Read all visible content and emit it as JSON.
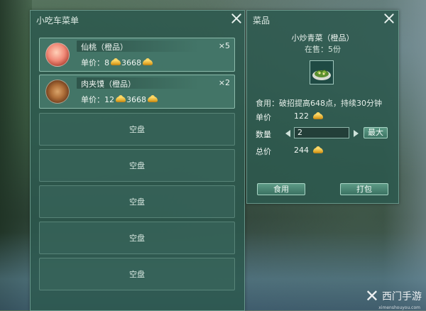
{
  "menu": {
    "title": "小吃车菜单",
    "items": [
      {
        "name": "仙桃（橙品）",
        "qty": "×5",
        "price_label": "单价：8",
        "price_total": "3668"
      },
      {
        "name": "肉夹馍（橙品）",
        "qty": "×2",
        "price_label": "单价：12",
        "price_total": "3668"
      }
    ],
    "empty_slots": [
      "空盘",
      "空盘",
      "空盘",
      "空盘",
      "空盘"
    ]
  },
  "dish": {
    "title": "菜品",
    "name": "小炒青菜（橙品）",
    "sale_info": "在售：5份",
    "effect": "食用：破招提高648点，持续30分钟",
    "unit_price_label": "单价",
    "unit_price": "122",
    "quantity_label": "数量",
    "quantity": "2",
    "max_label": "最大",
    "total_label": "总价",
    "total": "244",
    "eat_label": "食用",
    "pack_label": "打包"
  },
  "watermark": {
    "logo": "✕",
    "text": "西门手游",
    "url": "ximenshouyou.com"
  },
  "colors": {
    "panel_bg": "#2c584e",
    "border": "#96c8b9",
    "gold": "#e2a829"
  }
}
